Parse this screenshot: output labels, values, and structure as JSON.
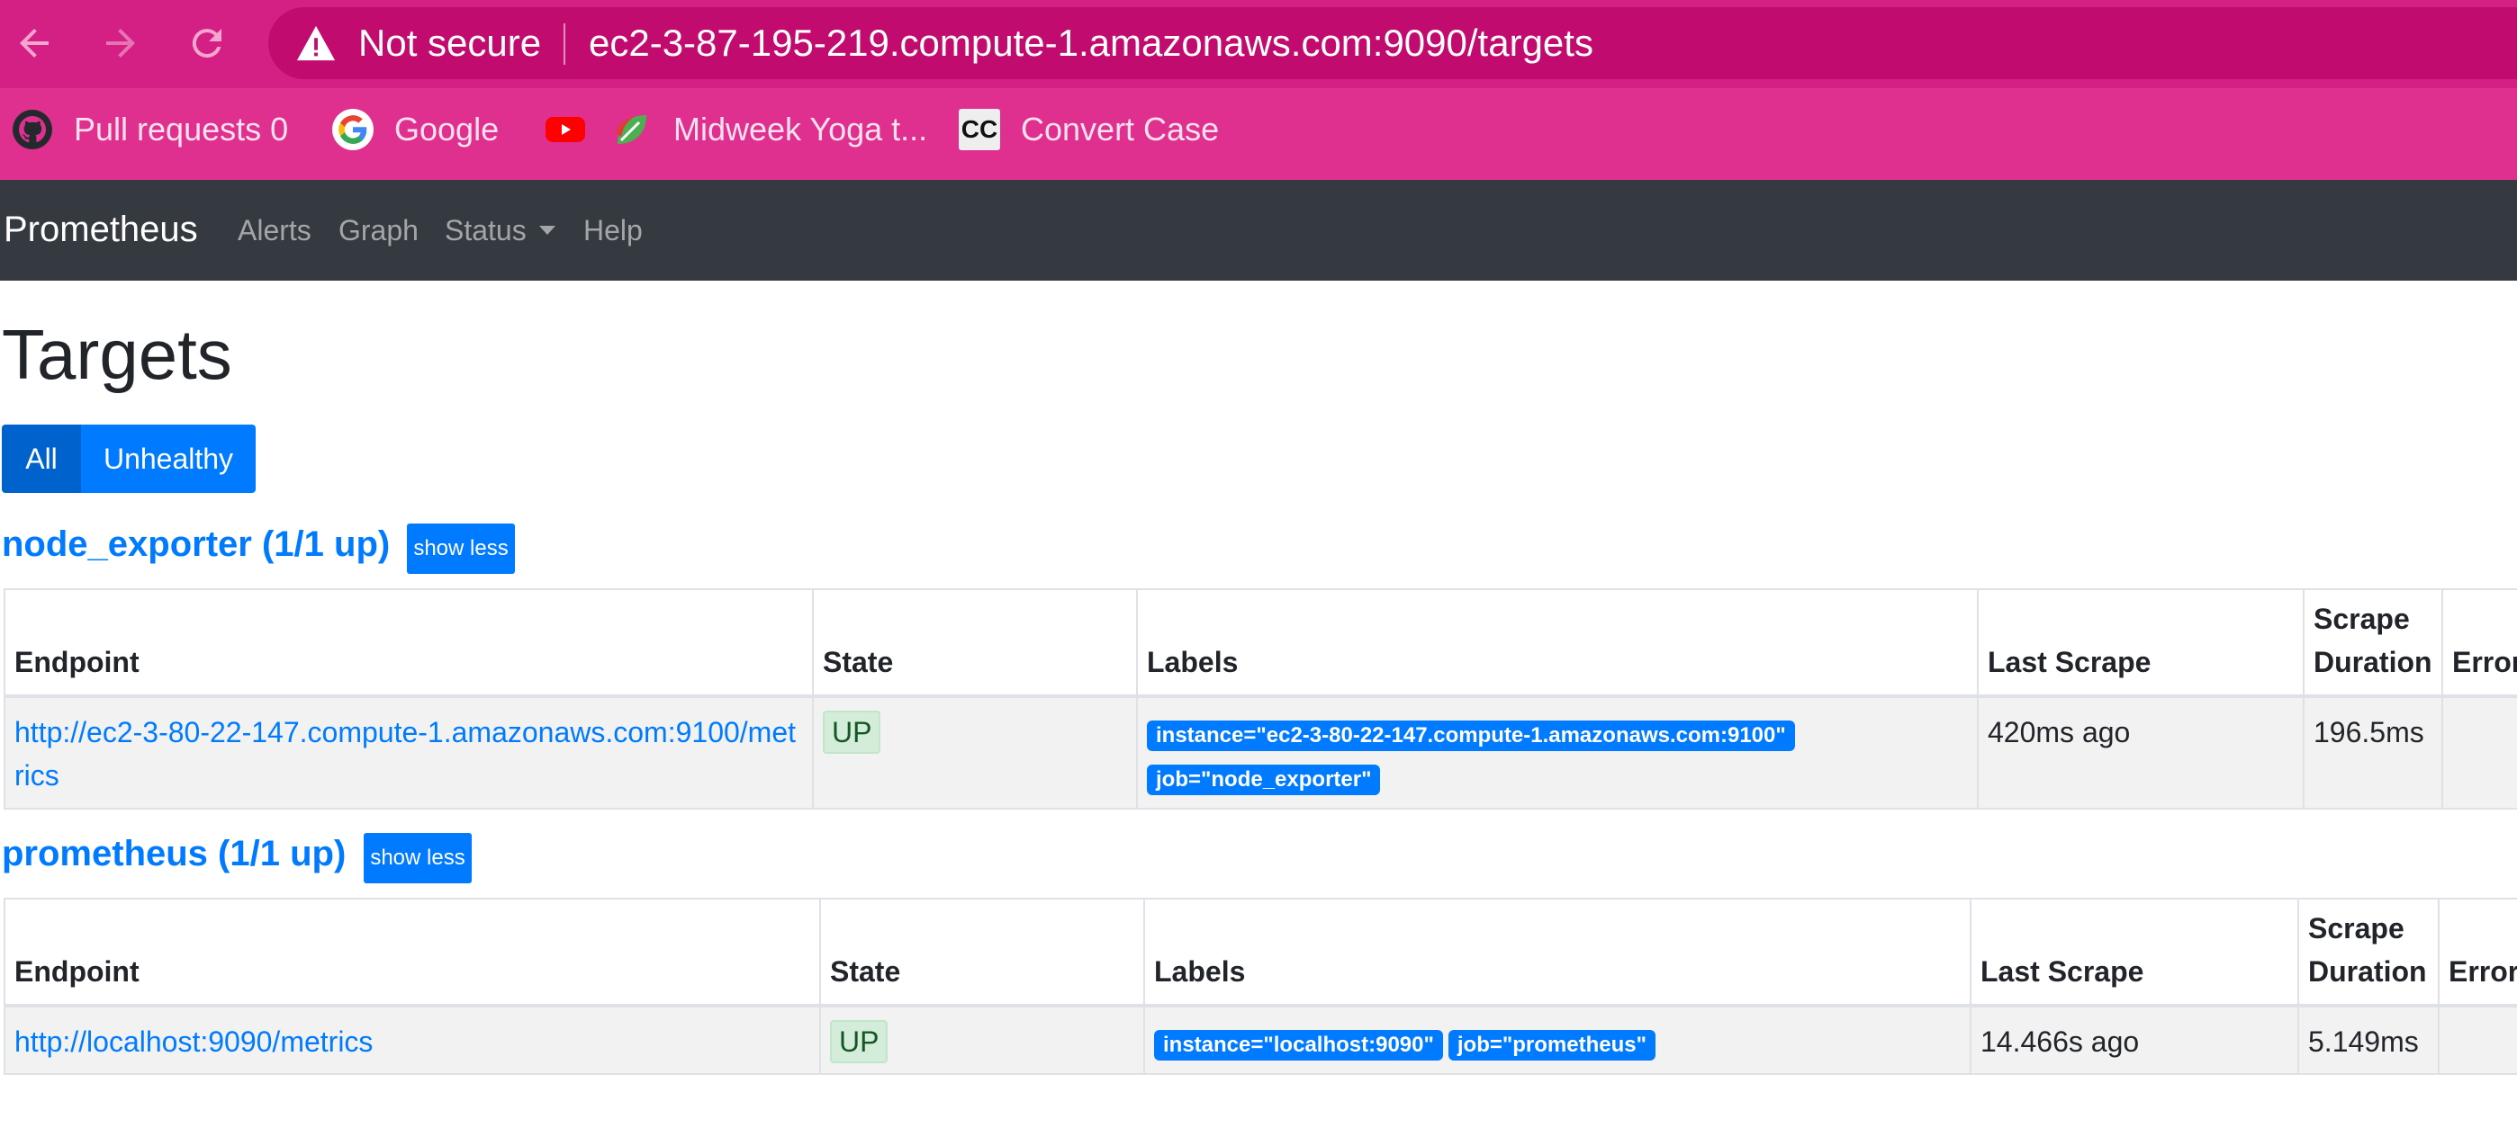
{
  "browser": {
    "security_label": "Not secure",
    "url": "ec2-3-87-195-219.compute-1.amazonaws.com:9090/targets",
    "bookmarks": [
      {
        "label": "Pull requests 0",
        "icon": "github-icon"
      },
      {
        "label": "Google",
        "icon": "google-icon"
      },
      {
        "label": "",
        "icon": "youtube-icon"
      },
      {
        "label": "Midweek Yoga t...",
        "icon": "leaf-icon"
      },
      {
        "label": "Convert Case",
        "icon": "cc-icon",
        "icon_text": "CC"
      }
    ]
  },
  "navbar": {
    "brand": "Prometheus",
    "links": [
      "Alerts",
      "Graph",
      "Status",
      "Help"
    ]
  },
  "page": {
    "title": "Targets",
    "filters": {
      "all": "All",
      "unhealthy": "Unhealthy"
    }
  },
  "colors": {
    "chrome": "#e0308f",
    "navbar": "#343a40",
    "primary": "#007bff",
    "up_badge_bg": "#d4edda"
  },
  "pools": [
    {
      "heading": "node_exporter (1/1 up)",
      "toggle_label": "show less",
      "columns": [
        "Endpoint",
        "State",
        "Labels",
        "Last Scrape",
        "Scrape Duration",
        "Error"
      ],
      "rows": [
        {
          "endpoint": "http://ec2-3-80-22-147.compute-1.amazonaws.com:9100/metrics",
          "state": "UP",
          "labels": [
            "instance=\"ec2-3-80-22-147.compute-1.amazonaws.com:9100\"",
            "job=\"node_exporter\""
          ],
          "last_scrape": "420ms ago",
          "scrape_duration": "196.5ms",
          "error": ""
        }
      ]
    },
    {
      "heading": "prometheus (1/1 up)",
      "toggle_label": "show less",
      "columns": [
        "Endpoint",
        "State",
        "Labels",
        "Last Scrape",
        "Scrape Duration",
        "Error"
      ],
      "rows": [
        {
          "endpoint": "http://localhost:9090/metrics",
          "state": "UP",
          "labels": [
            "instance=\"localhost:9090\"",
            "job=\"prometheus\""
          ],
          "last_scrape": "14.466s ago",
          "scrape_duration": "5.149ms",
          "error": ""
        }
      ]
    }
  ]
}
